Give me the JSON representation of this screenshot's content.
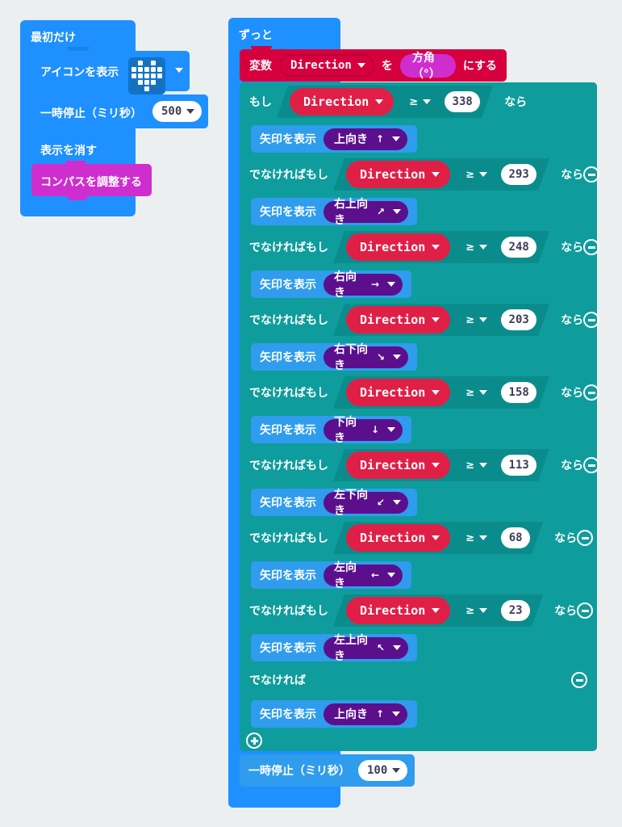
{
  "workspace": {
    "background_color": "#eceff0",
    "grid_color": "#dfe3e4"
  },
  "colors": {
    "event_blue": "#1e90ff",
    "basic_blue": "#2f9ced",
    "logic_teal": "#0f9c9c",
    "variable_red": "#d7003f",
    "input_magenta": "#cf2ecf",
    "arrow_purple": "#5b0f8c"
  },
  "on_start_script": {
    "hat_label": "最初だけ",
    "blocks": [
      {
        "label": "アイコンを表示",
        "field_type": "led-matrix",
        "icon_name": "heart-icon",
        "matrix": [
          [
            0,
            1,
            0,
            1,
            0
          ],
          [
            1,
            1,
            1,
            1,
            1
          ],
          [
            1,
            1,
            1,
            1,
            1
          ],
          [
            0,
            1,
            1,
            1,
            0
          ],
          [
            0,
            0,
            1,
            0,
            0
          ]
        ]
      },
      {
        "label": "一時停止（ミリ秒）",
        "field_type": "number-dropdown",
        "value": "500"
      },
      {
        "label": "表示を消す",
        "field_type": "none"
      },
      {
        "label": "コンパスを調整する",
        "field_type": "none",
        "color": "#cf2ecf"
      }
    ]
  },
  "forever_script": {
    "hat_label": "ずっと",
    "set_variable_block": {
      "prefix": "変数",
      "variable": "Direction",
      "middle": "を",
      "value_label": "方角（°）",
      "suffix": "にする"
    },
    "conditional": {
      "if_label": "もし",
      "elseif_label": "でなければもし",
      "else_label": "でなければ",
      "then_label": "なら",
      "operator": "≥",
      "variable": "Direction",
      "branches": [
        {
          "kind": "if",
          "threshold": "338",
          "arrow_label": "上向き",
          "arrow_glyph": "↑",
          "has_minus": false
        },
        {
          "kind": "elseif",
          "threshold": "293",
          "arrow_label": "右上向き",
          "arrow_glyph": "↗",
          "has_minus": true
        },
        {
          "kind": "elseif",
          "threshold": "248",
          "arrow_label": "右向き",
          "arrow_glyph": "→",
          "has_minus": true
        },
        {
          "kind": "elseif",
          "threshold": "203",
          "arrow_label": "右下向き",
          "arrow_glyph": "↘",
          "has_minus": true
        },
        {
          "kind": "elseif",
          "threshold": "158",
          "arrow_label": "下向き",
          "arrow_glyph": "↓",
          "has_minus": true
        },
        {
          "kind": "elseif",
          "threshold": "113",
          "arrow_label": "左下向き",
          "arrow_glyph": "↙",
          "has_minus": true
        },
        {
          "kind": "elseif",
          "threshold": "68",
          "arrow_label": "左向き",
          "arrow_glyph": "←",
          "has_minus": true
        },
        {
          "kind": "elseif",
          "threshold": "23",
          "arrow_label": "左上向き",
          "arrow_glyph": "↖",
          "has_minus": true
        },
        {
          "kind": "else",
          "threshold": "",
          "arrow_label": "上向き",
          "arrow_glyph": "↑",
          "has_minus": true
        }
      ],
      "arrow_block_label": "矢印を表示",
      "add_branch_label": "+"
    },
    "pause_block": {
      "label": "一時停止（ミリ秒）",
      "value": "100"
    }
  }
}
